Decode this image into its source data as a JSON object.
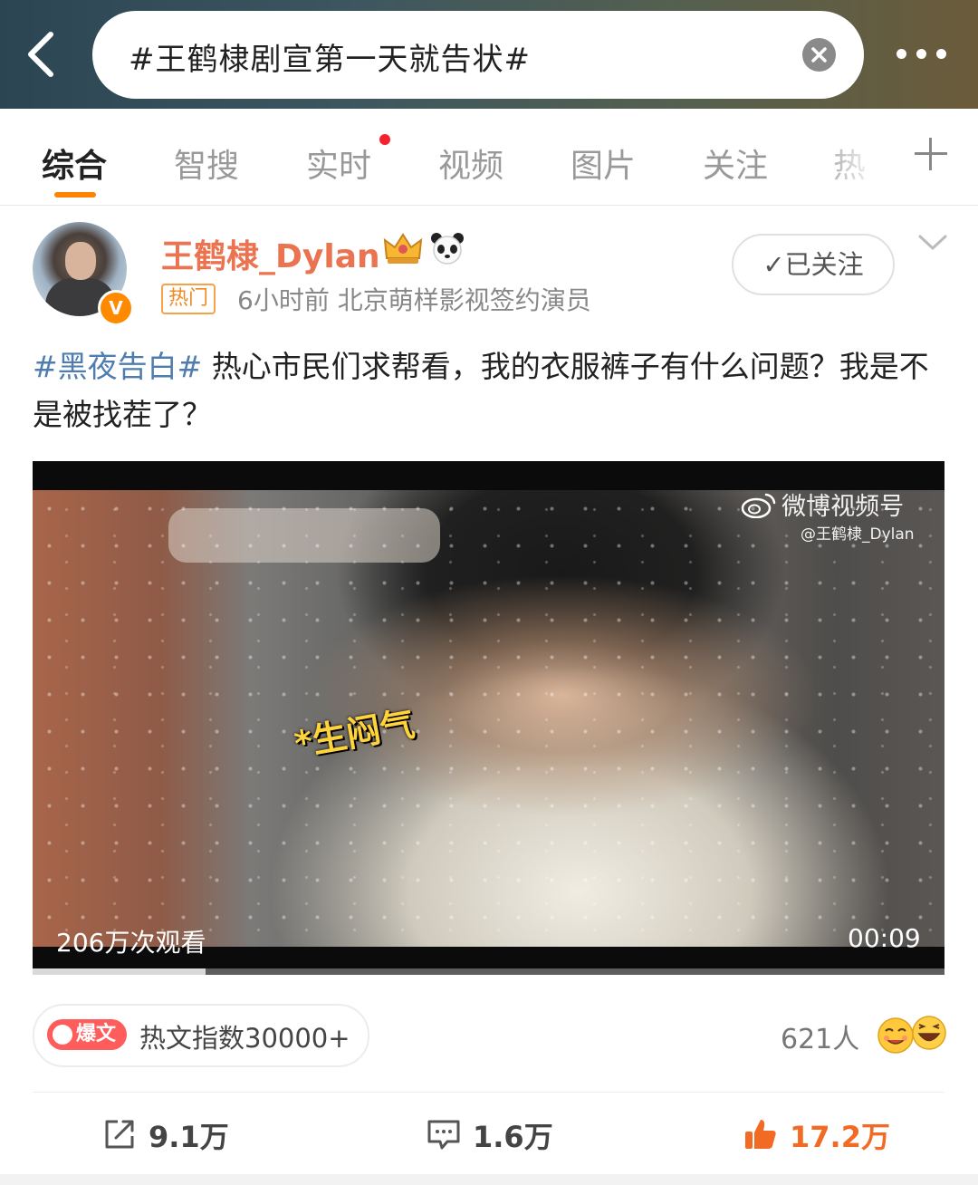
{
  "search": {
    "query": "#王鹤棣剧宣第一天就告状#"
  },
  "tabs": [
    {
      "label": "综合"
    },
    {
      "label": "智搜"
    },
    {
      "label": "实时"
    },
    {
      "label": "视频"
    },
    {
      "label": "图片"
    },
    {
      "label": "关注"
    },
    {
      "label": "热"
    }
  ],
  "post": {
    "author": "王鹤棣_Dylan",
    "verified_mark": "V",
    "hot_tag": "热门",
    "meta": "6小时前  北京萌样影视签约演员",
    "follow_label": "✓已关注",
    "hashtag": "#黑夜告白#",
    "text": " 热心市民们求帮看，我的衣服裤子有什么问题？我是不是被找茬了？"
  },
  "video": {
    "sticker": "*生闷气",
    "watermark_title": "微博视频号",
    "watermark_user": "@王鹤棣_Dylan",
    "views": "206万次观看",
    "duration": "00:09",
    "progress": 0.19
  },
  "hot_article": {
    "badge": "爆文",
    "index_text": "热文指数30000+"
  },
  "reactions": {
    "count": "621人"
  },
  "actions": {
    "repost": "9.1万",
    "comment": "1.6万",
    "like": "17.2万"
  },
  "colors": {
    "accent": "#ff8200",
    "username": "#eb7350",
    "hashtag": "#507daf",
    "like": "#f26b25",
    "baowen": "#ff5c5c"
  }
}
